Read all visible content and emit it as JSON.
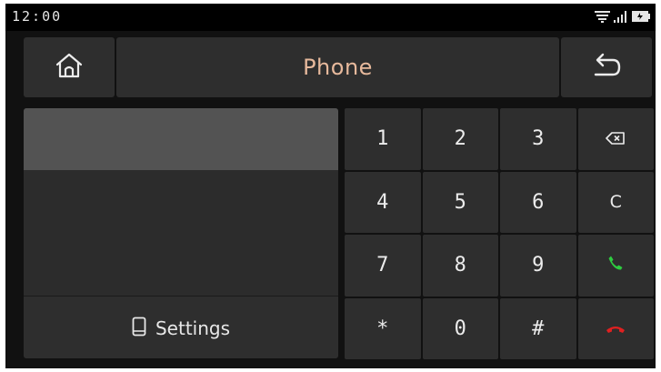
{
  "status_bar": {
    "time": "12:00",
    "icons": [
      "wifi-icon",
      "signal-icon",
      "battery-icon"
    ]
  },
  "header": {
    "home_icon": "home-icon",
    "title": "Phone",
    "back_icon": "back-arrow-icon"
  },
  "left_panel": {
    "number_display": "",
    "settings_icon": "phone-device-icon",
    "settings_label": "Settings"
  },
  "keypad": {
    "keys": [
      {
        "label": "1",
        "kind": "digit"
      },
      {
        "label": "2",
        "kind": "digit"
      },
      {
        "label": "3",
        "kind": "digit"
      },
      {
        "label": "",
        "kind": "backspace",
        "icon": "backspace-icon"
      },
      {
        "label": "4",
        "kind": "digit"
      },
      {
        "label": "5",
        "kind": "digit"
      },
      {
        "label": "6",
        "kind": "digit"
      },
      {
        "label": "C",
        "kind": "clear"
      },
      {
        "label": "7",
        "kind": "digit"
      },
      {
        "label": "8",
        "kind": "digit"
      },
      {
        "label": "9",
        "kind": "digit"
      },
      {
        "label": "",
        "kind": "call",
        "icon": "call-icon"
      },
      {
        "label": "*",
        "kind": "digit"
      },
      {
        "label": "0",
        "kind": "digit"
      },
      {
        "label": "#",
        "kind": "digit"
      },
      {
        "label": "",
        "kind": "hangup",
        "icon": "hang-up-icon"
      }
    ]
  },
  "colors": {
    "title": "#e7b99c",
    "call": "#2ecc40",
    "hangup": "#e02020",
    "tile": "#2e2e2e",
    "display": "#535353"
  }
}
